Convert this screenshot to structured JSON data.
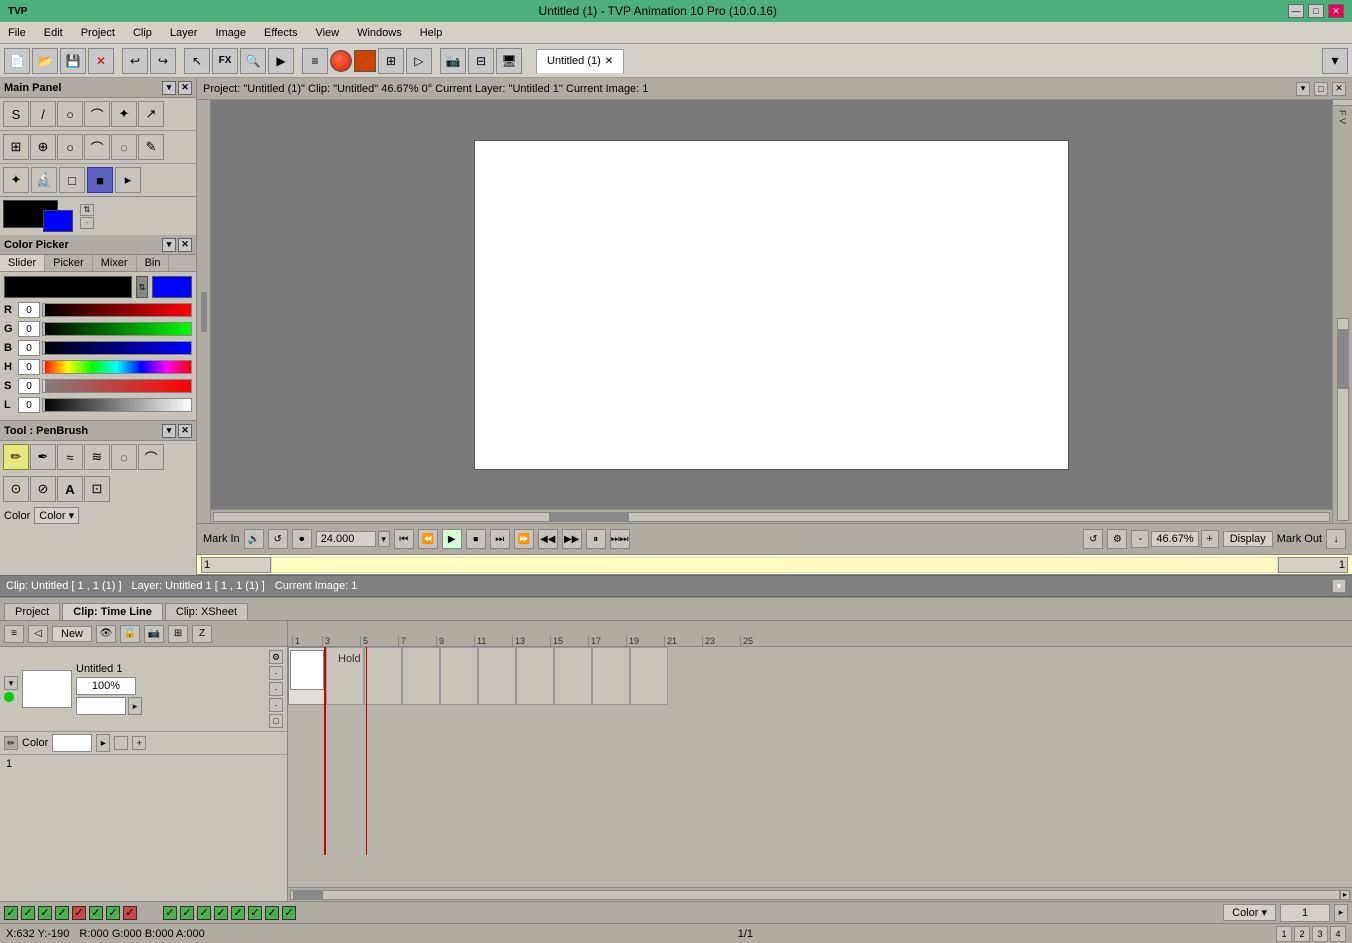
{
  "titlebar": {
    "title": "Untitled (1) - TVP Animation 10 Pro (10.0.16)",
    "app_name": "TVP",
    "min_label": "—",
    "max_label": "□",
    "close_label": "✕"
  },
  "menubar": {
    "items": [
      "File",
      "Edit",
      "Project",
      "Clip",
      "Layer",
      "Image",
      "Effects",
      "View",
      "Windows",
      "Help"
    ]
  },
  "toolbar": {
    "tab_label": "Untitled (1)",
    "tab_close": "✕",
    "zoom_level": "46.67%"
  },
  "main_panel": {
    "title": "Main Panel",
    "tools": [
      "✏",
      "⟋",
      "○",
      "⌒",
      "✦",
      "⊕",
      "⊙",
      "⊞",
      "↔",
      "⟐",
      "⌕",
      "⊡",
      "⊠",
      "◌",
      "⊳"
    ],
    "tools2": [
      "⌒",
      "⊗",
      "□",
      "☾",
      "◼",
      "▶"
    ]
  },
  "color_picker": {
    "title": "Color Picker",
    "tabs": [
      "Slider",
      "Picker",
      "Mixer",
      "Bin"
    ],
    "active_tab": "Slider",
    "primary_color": "#000000",
    "secondary_color": "#0000ff",
    "sliders": {
      "r": {
        "label": "R",
        "value": "0"
      },
      "g": {
        "label": "G",
        "value": "0"
      },
      "b": {
        "label": "B",
        "value": "0"
      },
      "h": {
        "label": "H",
        "value": "0"
      },
      "s": {
        "label": "S",
        "value": "0"
      },
      "l": {
        "label": "L",
        "value": "0"
      }
    }
  },
  "tool_panel": {
    "title": "Tool : PenBrush",
    "brushes": [
      "✏",
      "✒",
      "≈",
      "⟿",
      "≋",
      "◌",
      "⌒",
      "A",
      "⊡"
    ],
    "option_label": "Color",
    "option_value": "Color"
  },
  "project_bar": {
    "text": "Project: \"Untitled (1)\"  Clip: \"Untitled\"   46.67%   0°   Current Layer: \"Untitled 1\"  Current Image: 1"
  },
  "viewport": {
    "zoom": "46.67%"
  },
  "playback": {
    "mark_in": "Mark In",
    "mark_out": "Mark Out",
    "fps": "24.000",
    "display_btn": "Display",
    "zoom_value": "46.67%"
  },
  "frame_bar": {
    "frame_start": "1",
    "frame_end": "1"
  },
  "status_bar": {
    "clip_info": "Clip: Untitled [ 1 , 1  (1) ]",
    "layer_info": "Layer: Untitled 1 [ 1 , 1  (1) ]",
    "image_info": "Current Image: 1",
    "coords": "X:632  Y:-190",
    "color_info": "R:000 G:000 B:000 A:000",
    "page_info": "1/1",
    "pages": [
      "1",
      "2",
      "3",
      "4"
    ]
  },
  "bottom_tabs": {
    "tabs": [
      "Project",
      "Clip: Time Line",
      "Clip: XSheet"
    ],
    "active": "Clip: Time Line"
  },
  "timeline": {
    "new_btn": "New",
    "layer_name": "Untitled 1",
    "layer_percent": "100%",
    "color_label": "Color",
    "hold_label": "Hold",
    "frame_num": "1",
    "ruler": [
      "1",
      "3",
      "5",
      "7",
      "9",
      "11",
      "13",
      "15",
      "17",
      "19",
      "21",
      "23",
      "25"
    ]
  },
  "checkboxes": {
    "items": [
      "✓",
      "✓",
      "✓",
      "✓",
      "✓",
      "✓",
      "✓",
      "✓",
      "✓",
      "✓",
      "✓",
      "✓",
      "✓",
      "✓",
      "✓",
      "✓",
      "✓",
      "✓"
    ]
  }
}
